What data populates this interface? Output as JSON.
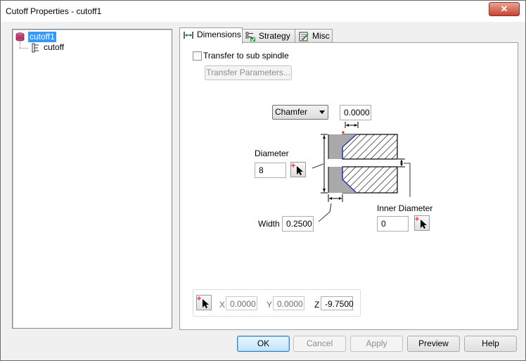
{
  "window": {
    "title": "Cutoff Properties - cutoff1",
    "close_symbol": "✕"
  },
  "tree": {
    "root_label": "cutoff1",
    "child_label": "cutoff"
  },
  "tabs": [
    {
      "label": "Dimensions",
      "active": true
    },
    {
      "label": "Strategy",
      "active": false
    },
    {
      "label": "Misc",
      "active": false
    }
  ],
  "dimensions": {
    "transfer_checkbox_label": "Transfer to sub spindle",
    "transfer_checked": false,
    "transfer_params_button": "Transfer Parameters...",
    "edge_type_selected": "Chamfer",
    "edge_value": "0.0000",
    "diameter_label": "Diameter",
    "diameter_value": "8",
    "inner_diameter_label": "Inner Diameter",
    "inner_diameter_value": "0",
    "width_label": "Width",
    "width_value": "0.2500",
    "coords": {
      "x_label": "X",
      "x_value": "0.0000",
      "y_label": "Y",
      "y_value": "0.0000",
      "z_label": "Z",
      "z_value": "-9.7500"
    }
  },
  "footer": {
    "ok": "OK",
    "cancel": "Cancel",
    "apply": "Apply",
    "preview": "Preview",
    "help": "Help"
  },
  "colors": {
    "selection": "#3399ff",
    "close_button": "#c7432f",
    "diagram_gray": "#a9a9a9",
    "diagram_blue": "#2030c0",
    "pick_red": "#ff0000"
  }
}
